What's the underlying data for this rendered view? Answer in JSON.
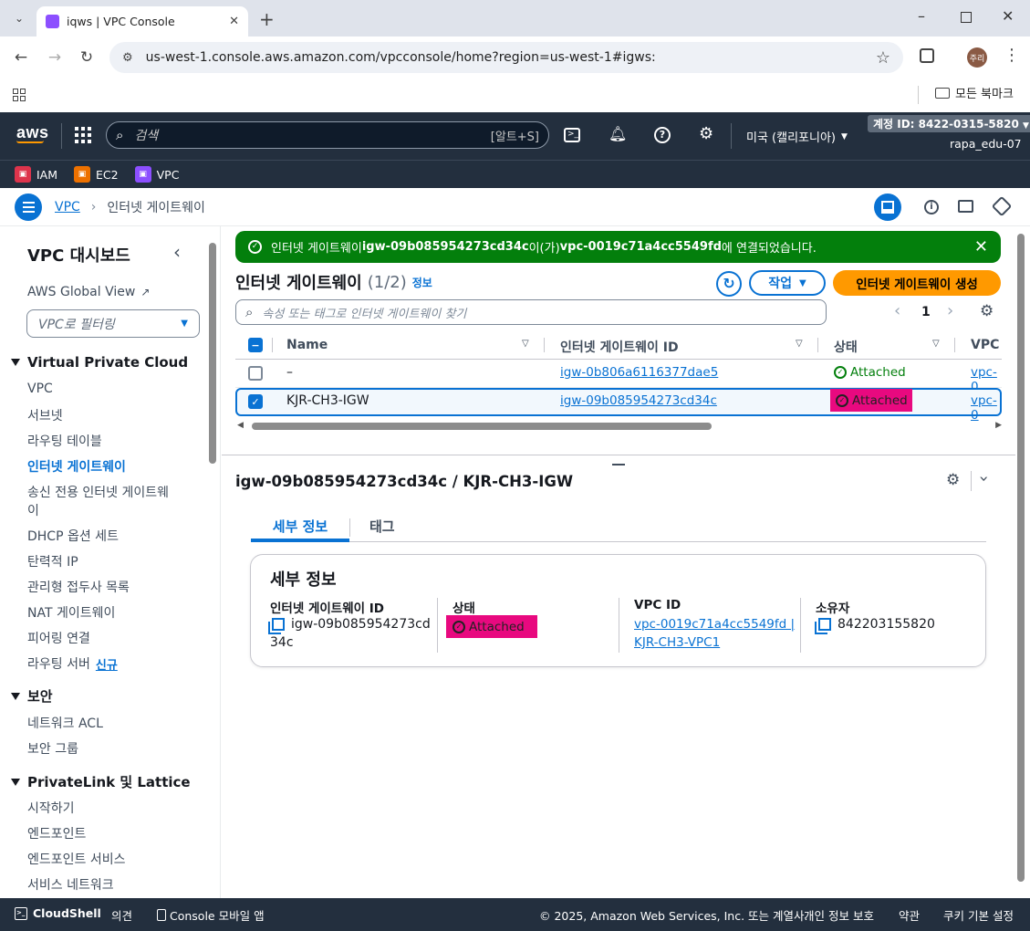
{
  "browser": {
    "tab_title": "iqws | VPC Console",
    "url": "us-west-1.console.aws.amazon.com/vpcconsole/home?region=us-west-1#igws:",
    "bookmarks_label": "모든 북마크",
    "profile_initials": "주리"
  },
  "aws_nav": {
    "logo": "aws",
    "search_placeholder": "검색",
    "search_shortcut": "[알트+S]",
    "region": "미국 (캘리포니아)",
    "account_id": "계정 ID: 8422-0315-5820",
    "username": "rapa_edu-07",
    "favorites": [
      "IAM",
      "EC2",
      "VPC"
    ]
  },
  "breadcrumb": {
    "root": "VPC",
    "current": "인터넷 게이트웨이"
  },
  "sidebar": {
    "title": "VPC 대시보드",
    "global_view": "AWS Global View",
    "filter_placeholder": "VPC로 필터링",
    "section1": "Virtual Private Cloud",
    "items1": [
      "VPC",
      "서브넷",
      "라우팅 테이블",
      "인터넷 게이트웨이",
      "송신 전용 인터넷 게이트웨",
      "이",
      "DHCP 옵션 세트",
      "탄력적 IP",
      "관리형 접두사 목록",
      "NAT 게이트웨이",
      "피어링 연결",
      "라우팅 서버"
    ],
    "new_badge": "신규",
    "section2": "보안",
    "items2": [
      "네트워크 ACL",
      "보안 그룹"
    ],
    "section3": "PrivateLink 및 Lattice",
    "items3": [
      "시작하기",
      "엔드포인트",
      "엔드포인트 서비스",
      "서비스 네트워크"
    ]
  },
  "flash": {
    "prefix": "인터넷 게이트웨이 ",
    "igw": "igw-09b085954273cd34c",
    "middle": "이(가) ",
    "vpc": "vpc-0019c71a4cc5549fd",
    "suffix": "에 연결되었습니다."
  },
  "table": {
    "title": "인터넷 게이트웨이",
    "count": "(1/2)",
    "info": "정보",
    "actions": "작업",
    "create": "인터넷 게이트웨이 생성",
    "search_placeholder": "속성 또는 태그로 인터넷 게이트웨이 찾기",
    "page": "1",
    "columns": [
      "Name",
      "인터넷 게이트웨이 ID",
      "상태",
      "VPC I"
    ],
    "rows": [
      {
        "name": "–",
        "id": "igw-0b806a6116377dae5",
        "state": "Attached",
        "vpc": "vpc-0",
        "selected": false
      },
      {
        "name": "KJR-CH3-IGW",
        "id": "igw-09b085954273cd34c",
        "state": "Attached",
        "vpc": "vpc-0",
        "selected": true
      }
    ]
  },
  "detail": {
    "title": "igw-09b085954273cd34c / KJR-CH3-IGW",
    "tabs": [
      "세부 정보",
      "태그"
    ],
    "card_title": "세부 정보",
    "labels": [
      "인터넷 게이트웨이 ID",
      "상태",
      "VPC ID",
      "소유자"
    ],
    "igw_line1": "igw-09b085954273cd",
    "igw_line2": "34c",
    "state": "Attached",
    "vpc_line1": "vpc-0019c71a4cc5549fd |",
    "vpc_line2": "KJR-CH3-VPC1",
    "owner": "842203155820"
  },
  "footer": {
    "cloudshell": "CloudShell",
    "feedback": "의견",
    "mobile": "Console 모바일 앱",
    "copyright": "© 2025, Amazon Web Services, Inc. 또는 계열사.",
    "privacy": "개인 정보 보호",
    "terms": "약관",
    "cookies": "쿠키 기본 설정"
  },
  "colors": {
    "accent": "#0972d3",
    "success": "#037f0c",
    "highlight": "#e8097f",
    "nav": "#232f3e",
    "create_btn": "#ff9900"
  }
}
